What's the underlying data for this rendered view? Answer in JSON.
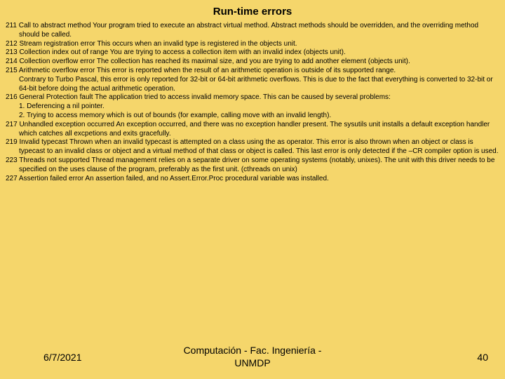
{
  "title": "Run-time errors",
  "errors": {
    "e211": "211 Call to abstract method Your program tried to execute an abstract virtual method. Abstract methods should be overridden, and the overriding method should be called.",
    "e212": "212 Stream registration error This occurs when an invalid type is registered in the objects unit.",
    "e213": "213 Collection index out of range You are trying to access a collection item with an invalid index (objects unit).",
    "e214": "214 Collection overflow error The collection has reached its maximal size, and you are trying to add another element (objects unit).",
    "e215a": "215 Arithmetic overflow error This error is reported when the result of an arithmetic operation is outside of its supported range.",
    "e215b": "Contrary to Turbo Pascal, this error is only reported for 32-bit or 64-bit arithmetic overflows. This is due to the fact that everything is converted to 32-bit or 64-bit before doing the actual arithmetic operation.",
    "e216": "216 General Protection fault The application tried to access invalid memory space. This can be caused by several problems:",
    "e216_1": "1. Deferencing a nil pointer.",
    "e216_2": "2. Trying to access memory which is out of bounds (for example, calling move with an invalid length).",
    "e217": "217 Unhandled exception occurred An exception occurred, and there was no exception handler present. The sysutils unit installs a default exception handler which catches all excpetions and exits gracefully.",
    "e219": "219 Invalid typecast Thrown when an invalid typecast is attempted on a class using the as operator. This error is also thrown when an object or class is typecast to an invalid class or object and a virtual method of that class or object is called. This last error is only detected if the –CR compiler option is used.",
    "e223": "223 Threads not supported Thread management relies on a separate driver on some operating systems (notably, unixes). The unit with this driver needs to be specified on the uses clause of the program, preferably as the first unit. (cthreads on unix)",
    "e227": "227 Assertion failed error An assertion failed, and no Assert.Error.Proc procedural variable was installed."
  },
  "footer": {
    "date": "6/7/2021",
    "center_line1": "Computación - Fac. Ingeniería -",
    "center_line2": "UNMDP",
    "page": "40"
  }
}
